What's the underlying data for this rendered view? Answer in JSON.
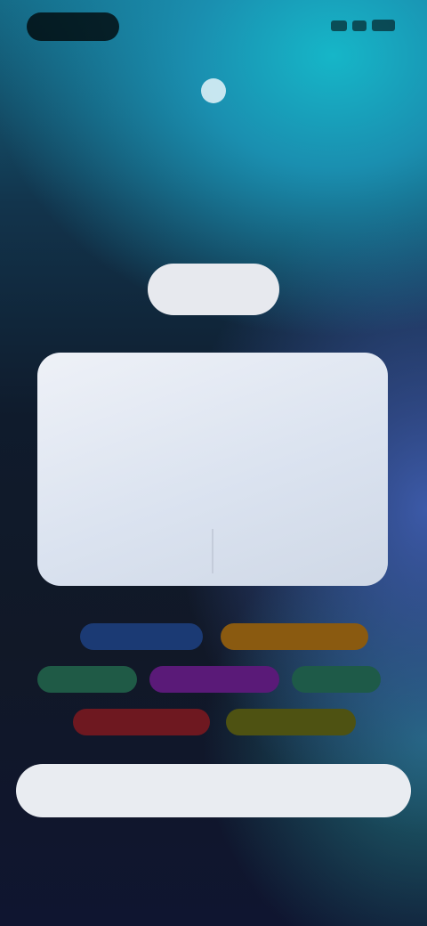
{
  "status_bar": {
    "time": "",
    "icons": [
      "signal-icon",
      "wifi-icon",
      "battery-icon"
    ]
  },
  "hero": {
    "icon": "sparkle-icon",
    "title_line1": "",
    "title_line2": ""
  },
  "pill_button": {
    "label": ""
  },
  "card": {
    "title": "",
    "body": "",
    "action_left": "",
    "action_right": ""
  },
  "tags": [
    {
      "label": "",
      "color": "#1b3a74"
    },
    {
      "label": "",
      "color": "#8a5a10"
    },
    {
      "label": "",
      "color": "#1f5a46"
    },
    {
      "label": "",
      "color": "#5a1a78"
    },
    {
      "label": "",
      "color": "#1e5a48"
    },
    {
      "label": "",
      "color": "#6e1820"
    },
    {
      "label": "",
      "color": "#4e5212"
    }
  ],
  "primary_button": {
    "label": ""
  },
  "footnote": {
    "line1": "",
    "line2_prefix": "",
    "line2_accent": "",
    "line2_suffix": ""
  },
  "colors": {
    "accent_green": "#1fa84e",
    "card_bg": "#dbe3f0",
    "button_bg": "#e9ecf1"
  }
}
